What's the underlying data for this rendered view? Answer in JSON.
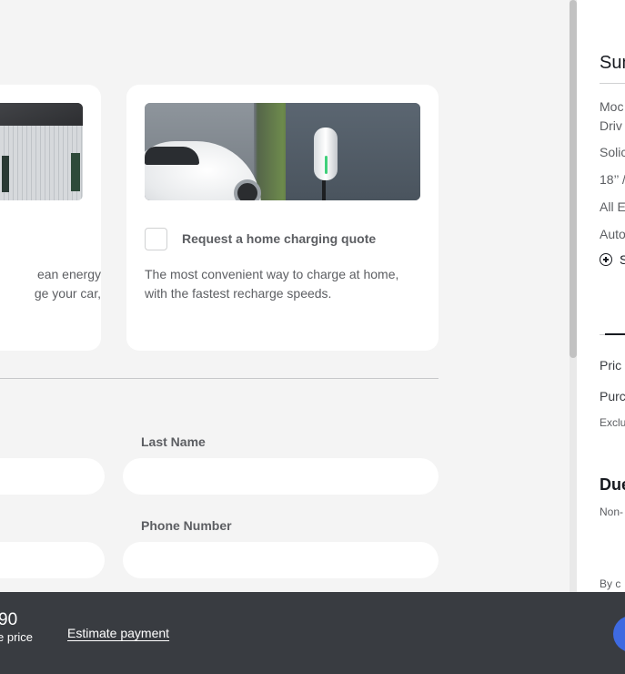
{
  "cards": {
    "left": {
      "desc_lines": [
        "ean energy",
        "ge your car,"
      ]
    },
    "right": {
      "checkbox_label": "Request a home charging quote",
      "desc": "The most convenient way to charge at home, with the fastest recharge speeds."
    }
  },
  "form": {
    "last_name_label": "Last Name",
    "phone_label": "Phone Number",
    "first_name_value": "",
    "last_name_value": "",
    "email_value": "",
    "phone_value": ""
  },
  "summary": {
    "title": "Sum",
    "items": [
      "Moc",
      "Driv",
      "Solic",
      "18’’ /",
      "All E",
      "Auto"
    ],
    "add_label": "S",
    "price_row": "Pric",
    "purchase_row": "Purc",
    "exclu_row": "Exclu",
    "due_head": "Due",
    "non_row": "Non-",
    "by_row": "By c"
  },
  "bottom_bar": {
    "price": "90",
    "price_caption": "e price",
    "estimate_label": "Estimate payment"
  },
  "colors": {
    "accent": "#3e6ae1",
    "bar": "#393c41",
    "page_bg": "#f4f4f4"
  }
}
